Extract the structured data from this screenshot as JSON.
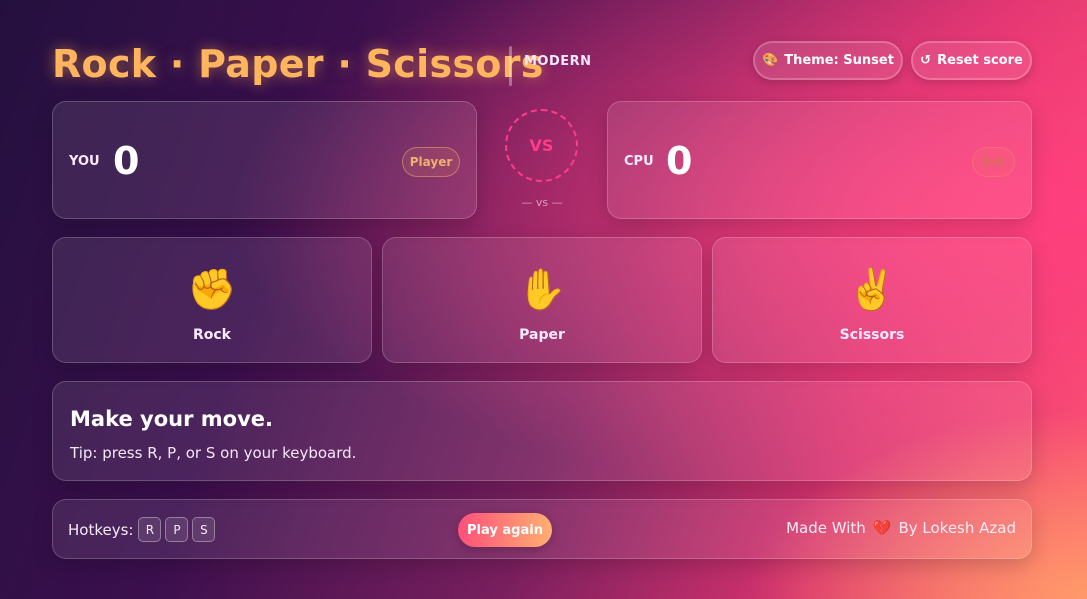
{
  "header": {
    "title": "Rock · Paper · Scissors",
    "subtitle": "MODERN",
    "theme_label": "Theme: Sunset",
    "reset_label": "Reset score"
  },
  "icons": {
    "palette": "🎨",
    "reset": "↺",
    "rock": "✊",
    "paper": "✋",
    "scissors": "✌️",
    "heart": "💔"
  },
  "scoreboard": {
    "player": {
      "label": "YOU",
      "score": "0",
      "tag": "Player"
    },
    "vs": "VS",
    "vs_small": "— vs —",
    "cpu": {
      "label": "CPU",
      "score": "0",
      "tag": "Bot"
    }
  },
  "moves": [
    {
      "label": "Rock"
    },
    {
      "label": "Paper"
    },
    {
      "label": "Scissors"
    }
  ],
  "message": {
    "title": "Make your move.",
    "tip": "Tip: press R, P, or S on your keyboard."
  },
  "footer": {
    "hotkeys_label": "Hotkeys:",
    "keys": [
      "R",
      "P",
      "S"
    ],
    "play_again": "Play again",
    "credit_prefix": "Made With",
    "credit_suffix": "By Lokesh Azad"
  },
  "colors": {
    "accent": "#ffb45e",
    "vs": "#ff3b8a",
    "play_start": "#ff4f7b",
    "play_end": "#ffb070"
  }
}
